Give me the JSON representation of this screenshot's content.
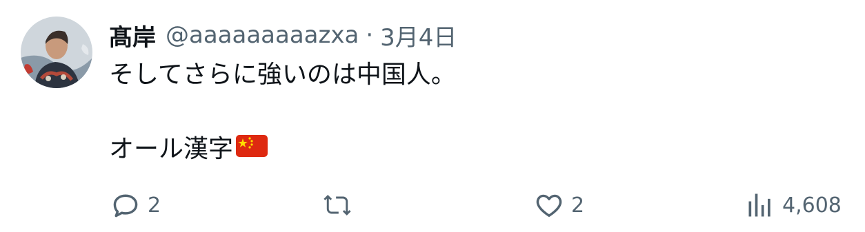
{
  "tweet": {
    "author_name": "髙岸",
    "handle": "@aaaaaaaaazxa",
    "separator": "·",
    "timestamp": "3月4日",
    "text_line1": "そしてさらに強いのは中国人。",
    "text_line2": "オール漢字",
    "emoji": "china-flag-emoji"
  },
  "actions": {
    "reply_count": "2",
    "retweet_count": "",
    "like_count": "2",
    "views_count": "4,608"
  },
  "icons": {
    "reply": "reply-icon",
    "retweet": "retweet-icon",
    "like": "heart-icon",
    "views": "analytics-icon"
  },
  "colors": {
    "text": "#0f1419",
    "secondary": "#536471",
    "flag_red": "#de2910",
    "flag_yellow": "#ffde00"
  }
}
